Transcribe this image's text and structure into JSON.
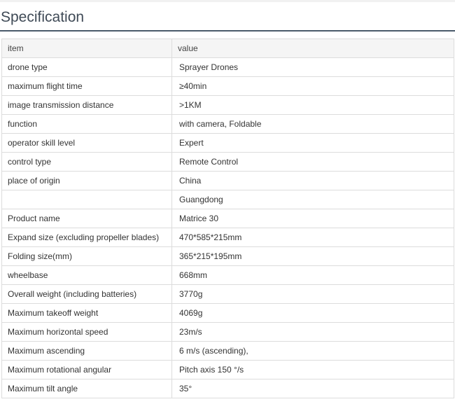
{
  "page": {
    "title": "Specification"
  },
  "table": {
    "headers": [
      "item",
      "value"
    ],
    "rows": [
      {
        "item": "drone type",
        "value": "Sprayer Drones"
      },
      {
        "item": "maximum flight time",
        "value": "≥40min"
      },
      {
        "item": "image transmission distance",
        "value": ">1KM"
      },
      {
        "item": "function",
        "value": "with camera, Foldable"
      },
      {
        "item": "operator skill level",
        "value": "Expert"
      },
      {
        "item": "control type",
        "value": "Remote Control"
      },
      {
        "item": "place of origin",
        "value": "China"
      },
      {
        "item": "",
        "value": "Guangdong"
      },
      {
        "item": "Product name",
        "value": "Matrice 30"
      },
      {
        "item": "Expand size (excluding propeller blades)",
        "value": "470*585*215mm"
      },
      {
        "item": "Folding size(mm)",
        "value": "365*215*195mm"
      },
      {
        "item": "wheelbase",
        "value": "668mm"
      },
      {
        "item": "Overall weight (including batteries)",
        "value": "3770g"
      },
      {
        "item": "Maximum takeoff weight",
        "value": "4069g"
      },
      {
        "item": "Maximum horizontal speed",
        "value": "23m/s"
      },
      {
        "item": "Maximum ascending",
        "value": "6 m/s (ascending),"
      },
      {
        "item": "Maximum rotational angular",
        "value": "Pitch axis 150 °/s"
      },
      {
        "item": "Maximum tilt angle",
        "value": "35°"
      }
    ]
  }
}
